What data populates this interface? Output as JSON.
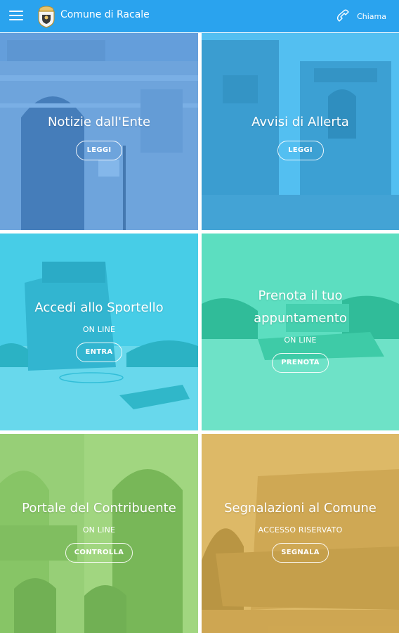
{
  "appbar": {
    "title": "Comune di Racale",
    "call_label": "Chiama",
    "color": "#2aa3ee",
    "menu_icon": "hamburger-menu-icon",
    "crest_icon": "municipal-crest-icon",
    "call_icon": "phone-icon"
  },
  "tiles": [
    {
      "title": "Notizie dall'Ente",
      "subtitle": "",
      "button": "LEGGI",
      "overlay_color": "#4a9ae8"
    },
    {
      "title": "Avvisi di Allerta",
      "subtitle": "",
      "button": "LEGGI",
      "overlay_color": "#2fb6f2"
    },
    {
      "title": "Accedi allo Sportello",
      "subtitle": "ON LINE",
      "button": "ENTRA",
      "overlay_color": "#28c6e4"
    },
    {
      "title": "Prenota il tuo appuntamento",
      "subtitle": "ON LINE",
      "button": "PRENOTA",
      "overlay_color": "#33d6b4"
    },
    {
      "title": "Portale del Contribuente",
      "subtitle": "ON LINE",
      "button": "CONTROLLA",
      "overlay_color": "#8ed06c"
    },
    {
      "title": "Segnalazioni al Comune",
      "subtitle": "ACCESSO RISERVATO",
      "button": "SEGNALA",
      "overlay_color": "#d4a84a"
    }
  ]
}
